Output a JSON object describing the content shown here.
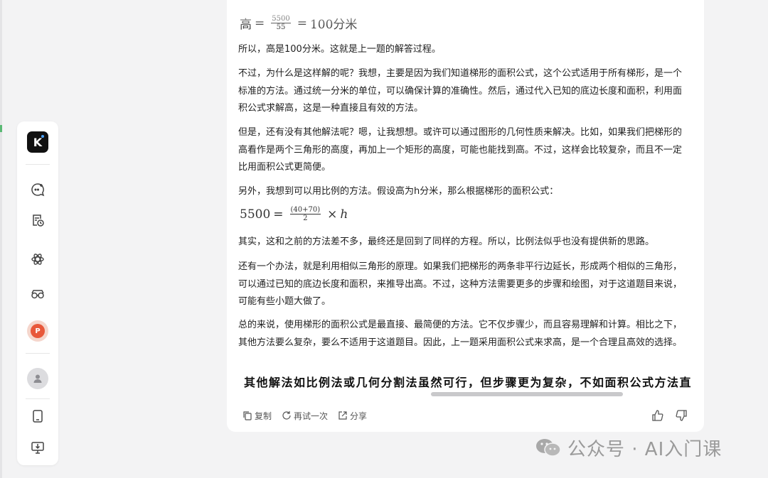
{
  "sidebar": {
    "logo_letter": "K",
    "items": [
      "new-chat",
      "history",
      "apps",
      "assistants",
      "ppt",
      "account",
      "mobile",
      "desktop-download"
    ],
    "ppt_label": "P"
  },
  "message": {
    "formula_top": {
      "lhs": "高",
      "eq1": "=",
      "num": "5500",
      "den": "55",
      "eq2": "=",
      "rhs": "100分米"
    },
    "p1": "所以，高是100分米。这就是上一题的解答过程。",
    "p2": "不过，为什么是这样解的呢？我想，主要是因为我们知道梯形的面积公式，这个公式适用于所有梯形，是一个标准的方法。通过统一分米的单位，可以确保计算的准确性。然后，通过代入已知的底边长度和面积，利用面积公式求解高，这是一种直接且有效的方法。",
    "p3": "但是，还有没有其他解法呢？嗯，让我想想。或许可以通过图形的几何性质来解决。比如，如果我们把梯形的高看作是两个三角形的高度，再加上一个矩形的高度，可能也能找到高。不过，这样会比较复杂，而且不一定比用面积公式更简便。",
    "p4": "另外，我想到可以用比例的方法。假设高为h分米，那么根据梯形的面积公式：",
    "formula_mid": {
      "lhs": "5500",
      "eq": "=",
      "num": "(40+70)",
      "den": "2",
      "times": "×",
      "var": "h"
    },
    "p5": "其实，这和之前的方法差不多，最终还是回到了同样的方程。所以，比例法似乎也没有提供新的思路。",
    "p6": "还有一个办法，就是利用相似三角形的原理。如果我们把梯形的两条非平行边延长，形成两个相似的三角形，可以通过已知的底边长度和面积，来推导出高。不过，这种方法需要更多的步骤和绘图，对于这道题目来说，可能有些小题大做了。",
    "p7": "总的来说，使用梯形的面积公式是最直接、最简便的方法。它不仅步骤少，而且容易理解和计算。相比之下，其他方法要么复杂，要么不适用于这道题目。因此，上一题采用面积公式来求高，是一个合理且高效的选择。",
    "bold_line": "其他解法如比例法或几何分割法虽然可行，但步骤更为复杂，不如面积公式方法直"
  },
  "actions": {
    "copy": "复制",
    "retry": "再试一次",
    "share": "分享"
  },
  "watermark": {
    "text": "公众号 · AI入门课"
  },
  "colors": {
    "page_bg": "#f3f3f4",
    "card_bg": "#ffffff",
    "text": "#1f1f1f",
    "muted": "#555555",
    "scrollbar": "#c9c9cb",
    "ppt_accent": "#e8583a"
  }
}
